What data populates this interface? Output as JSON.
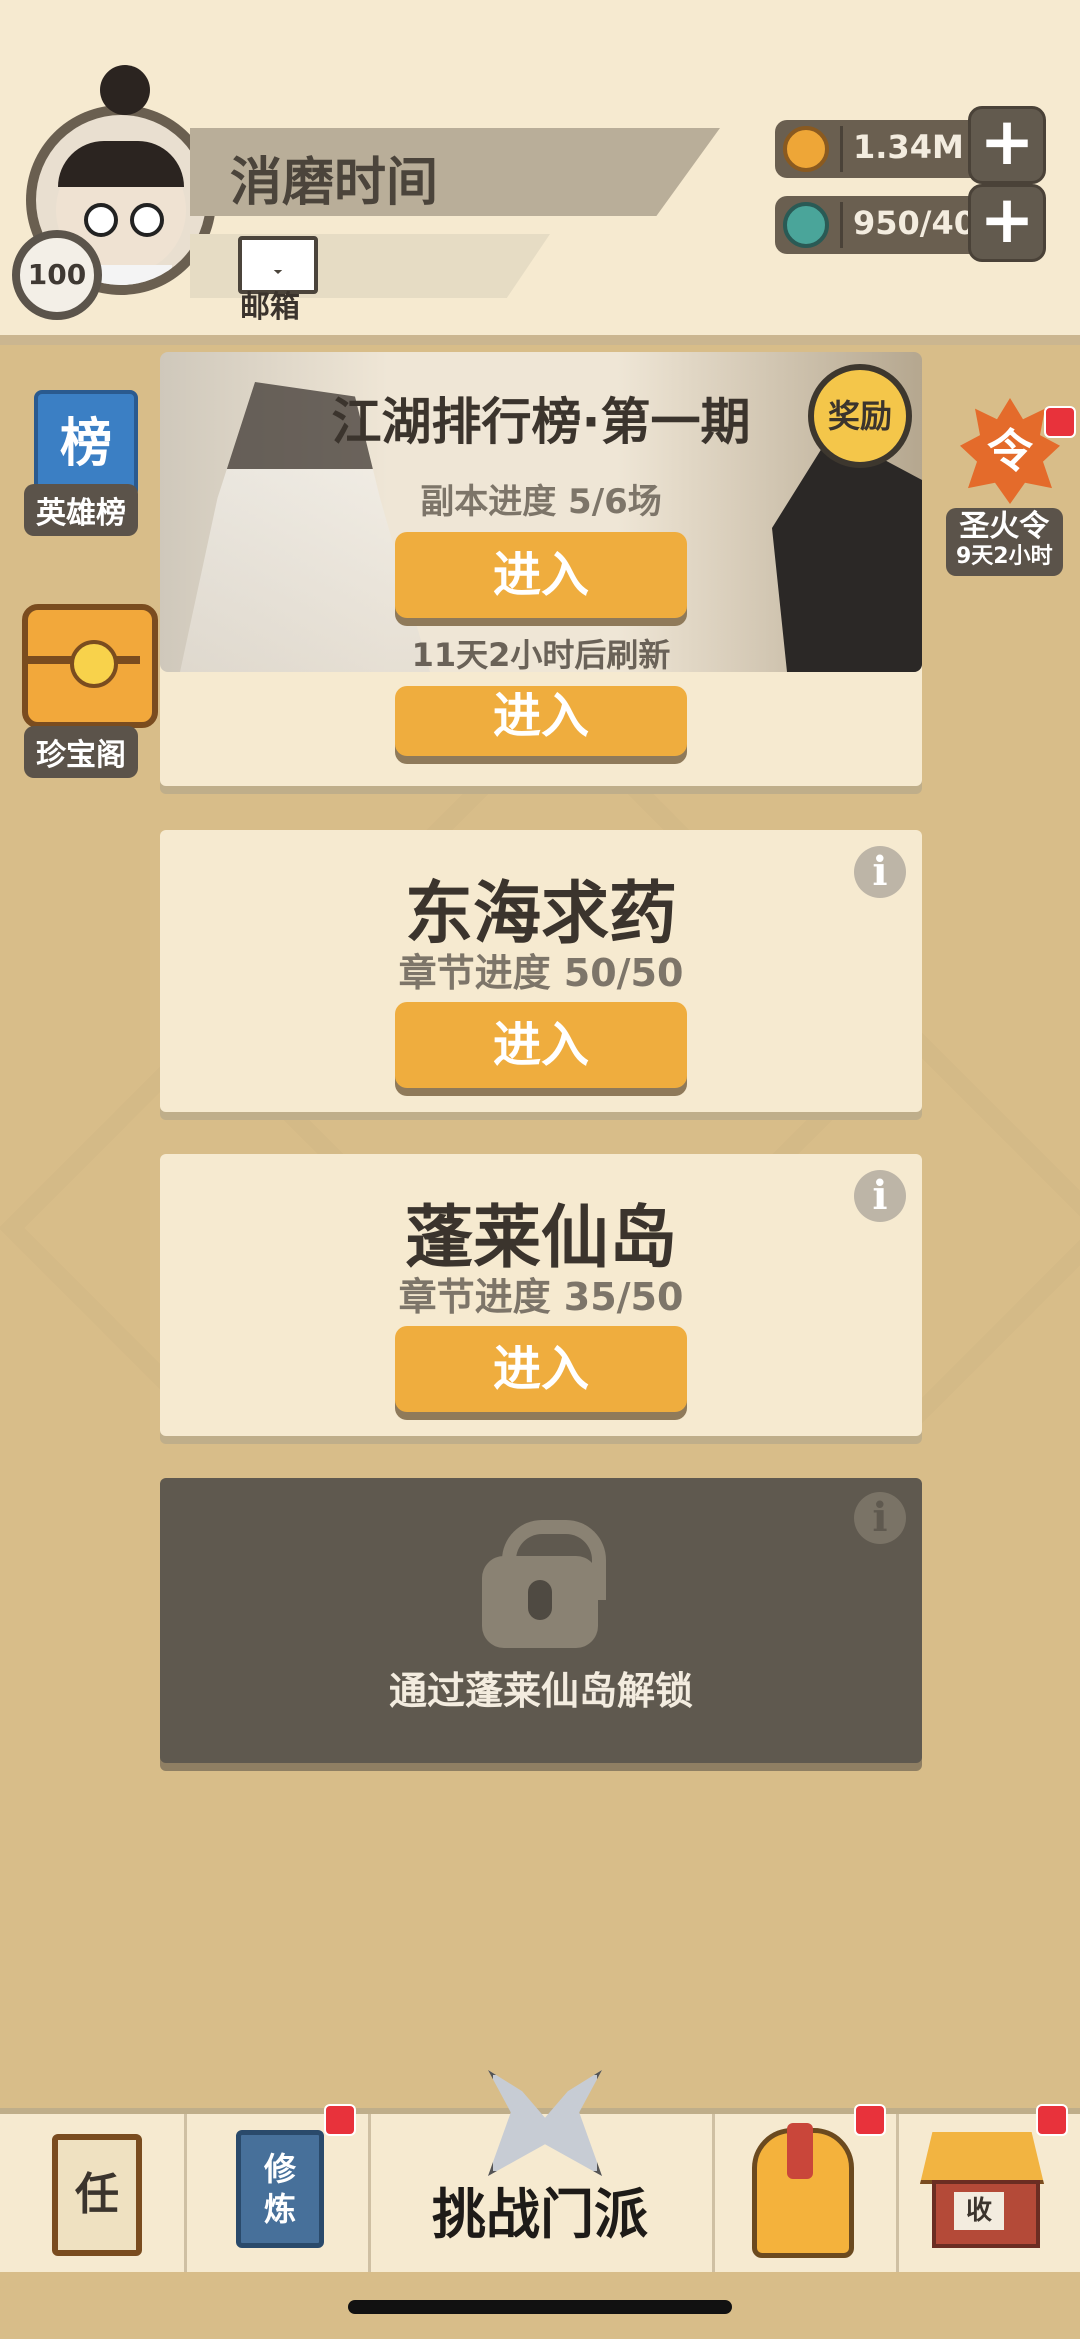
{
  "player": {
    "name": "消磨时间",
    "level": "100",
    "mail_label": "邮箱"
  },
  "currency": {
    "coins": "1.34M",
    "gems": "950/40",
    "plus": "+"
  },
  "side_left": {
    "rank_icon_char": "榜",
    "rank_label": "英雄榜",
    "treasure_label": "珍宝阁"
  },
  "side_right": {
    "fire_char": "令",
    "fire_label": "圣火令",
    "fire_timer": "9天2小时"
  },
  "banner": {
    "title": "江湖排行榜·第一期",
    "progress": "副本进度 5/6场",
    "enter": "进入",
    "refresh": "11天2小时后刷新",
    "reward": "奖励"
  },
  "cards": [
    {
      "title": "",
      "progress": "",
      "enter": "进入"
    },
    {
      "title": "东海求药",
      "progress": "章节进度 50/50",
      "enter": "进入",
      "info": "i"
    },
    {
      "title": "蓬莱仙岛",
      "progress": "章节进度 35/50",
      "enter": "进入",
      "info": "i"
    }
  ],
  "locked": {
    "text": "通过蓬莱仙岛解锁",
    "info": "i"
  },
  "bottom_nav": {
    "task_char": "任",
    "train_char": "修\n炼",
    "center_label": "挑战门派",
    "shop_char": "收"
  }
}
